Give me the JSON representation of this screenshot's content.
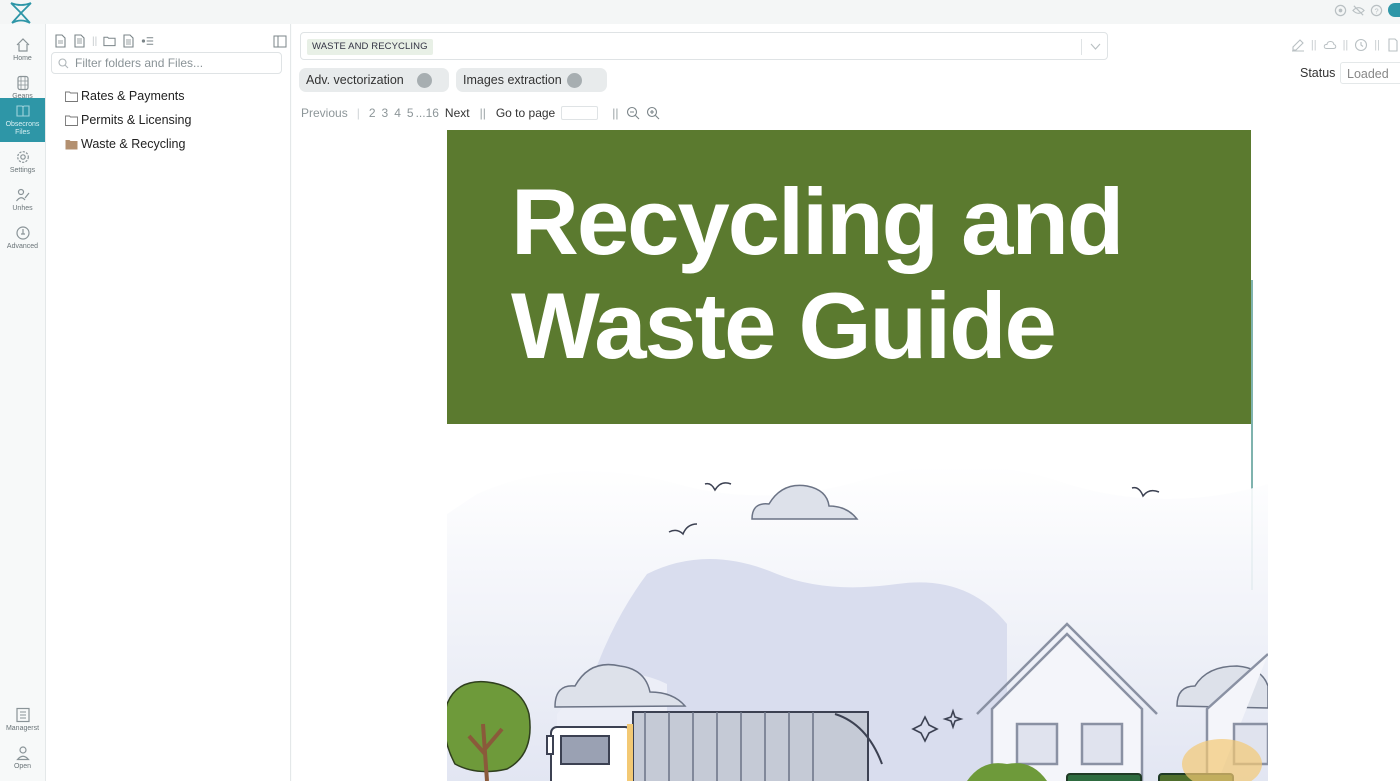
{
  "nav": {
    "items": [
      {
        "label": "Home",
        "icon": "home-icon"
      },
      {
        "label": "Geans",
        "icon": "database-icon"
      },
      {
        "label": "Obsecrons Files",
        "icon": "files-icon",
        "active": true
      },
      {
        "label": "Settings",
        "icon": "gear-icon"
      },
      {
        "label": "Unhes",
        "icon": "users-icon"
      },
      {
        "label": "Advanced",
        "icon": "info-icon"
      }
    ],
    "bottom": [
      {
        "label": "Managerst",
        "icon": "manager-icon"
      },
      {
        "label": "Open",
        "icon": "user-icon"
      }
    ]
  },
  "filepanel": {
    "filter_placeholder": "Filter folders and Files...",
    "tree": [
      {
        "label": "Rates & Payments",
        "type": "folder"
      },
      {
        "label": "Permits & Licensing",
        "type": "folder"
      },
      {
        "label": "Waste & Recycling",
        "type": "folder-open"
      }
    ]
  },
  "viewer": {
    "document_chip": "WASTE AND RECYCLING",
    "toggles": {
      "adv_vectorization": "Adv. vectorization",
      "images_extraction": "Images extraction"
    },
    "status_label": "Status",
    "status_value": "Loaded",
    "pager": {
      "previous": "Previous",
      "pages": [
        "2",
        "3",
        "4",
        "5",
        "...16"
      ],
      "next": "Next",
      "goto": "Go to page"
    },
    "document_title_line1": "Recycling and",
    "document_title_line2": "Waste Guide"
  },
  "colors": {
    "accent": "#2e96a7",
    "banner": "#5b7a2f"
  }
}
